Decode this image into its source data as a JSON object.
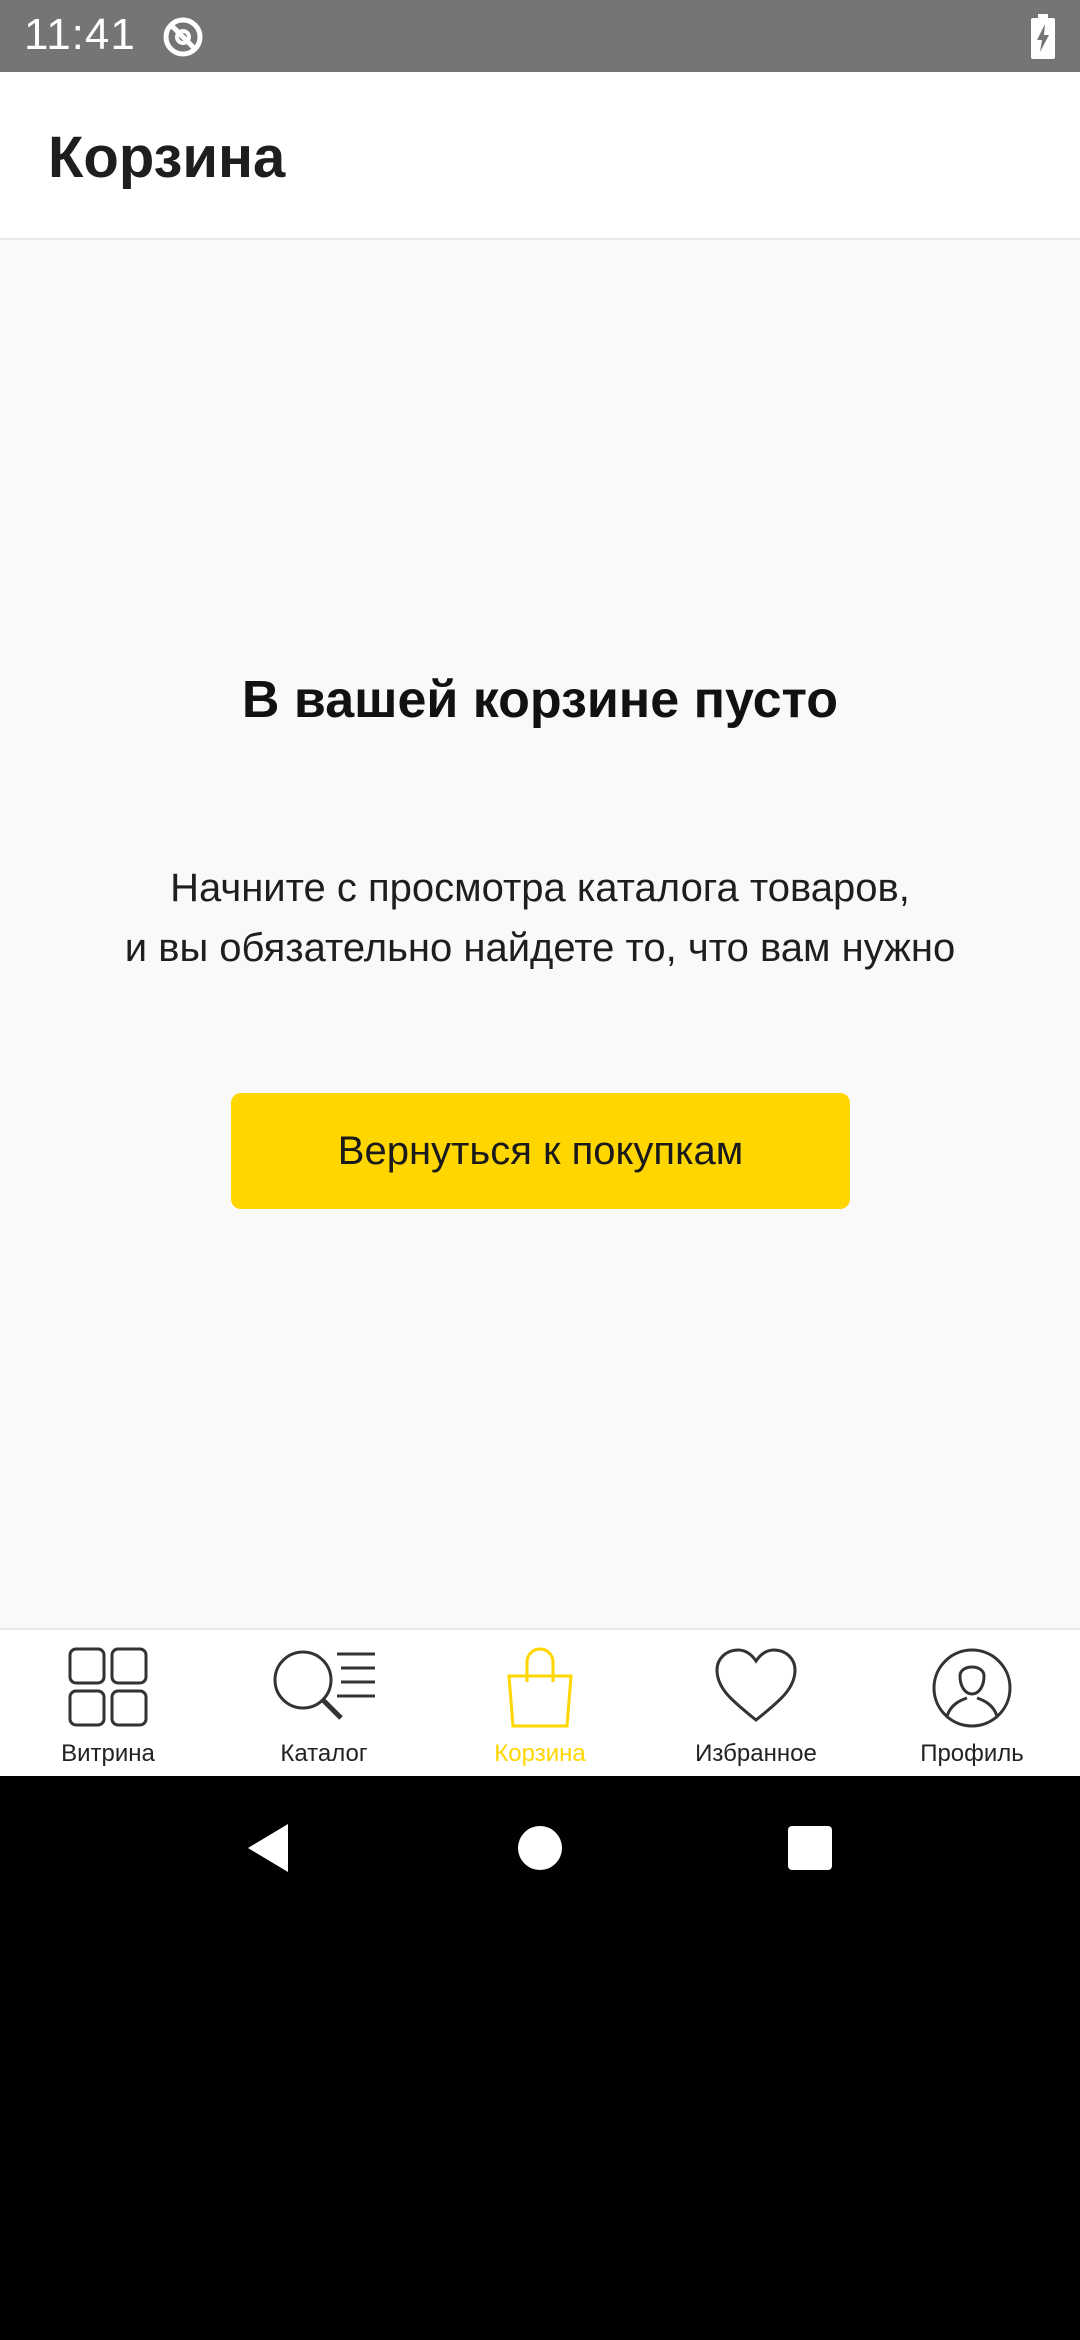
{
  "status_bar": {
    "time": "11:41",
    "icons": [
      "sync-icon",
      "battery-charging-icon"
    ]
  },
  "app_bar": {
    "title": "Корзина"
  },
  "empty_state": {
    "title": "В вашей корзине пусто",
    "description_line1": "Начните с просмотра каталога товаров,",
    "description_line2": "и вы обязательно найдете то, что вам нужно",
    "button_label": "Вернуться к покупкам"
  },
  "bottom_nav": {
    "items": [
      {
        "label": "Витрина",
        "icon": "showcase-grid-icon",
        "active": false
      },
      {
        "label": "Каталог",
        "icon": "catalog-search-icon",
        "active": false
      },
      {
        "label": "Корзина",
        "icon": "shopping-bag-icon",
        "active": true
      },
      {
        "label": "Избранное",
        "icon": "heart-icon",
        "active": false
      },
      {
        "label": "Профиль",
        "icon": "profile-icon",
        "active": false
      }
    ]
  },
  "system_nav": {
    "buttons": [
      "back-icon",
      "home-icon",
      "recents-icon"
    ]
  },
  "colors": {
    "accent": "#ffd600",
    "status_bar": "#757575",
    "content_bg": "#f9f9f9",
    "text": "#1e1e1e"
  }
}
